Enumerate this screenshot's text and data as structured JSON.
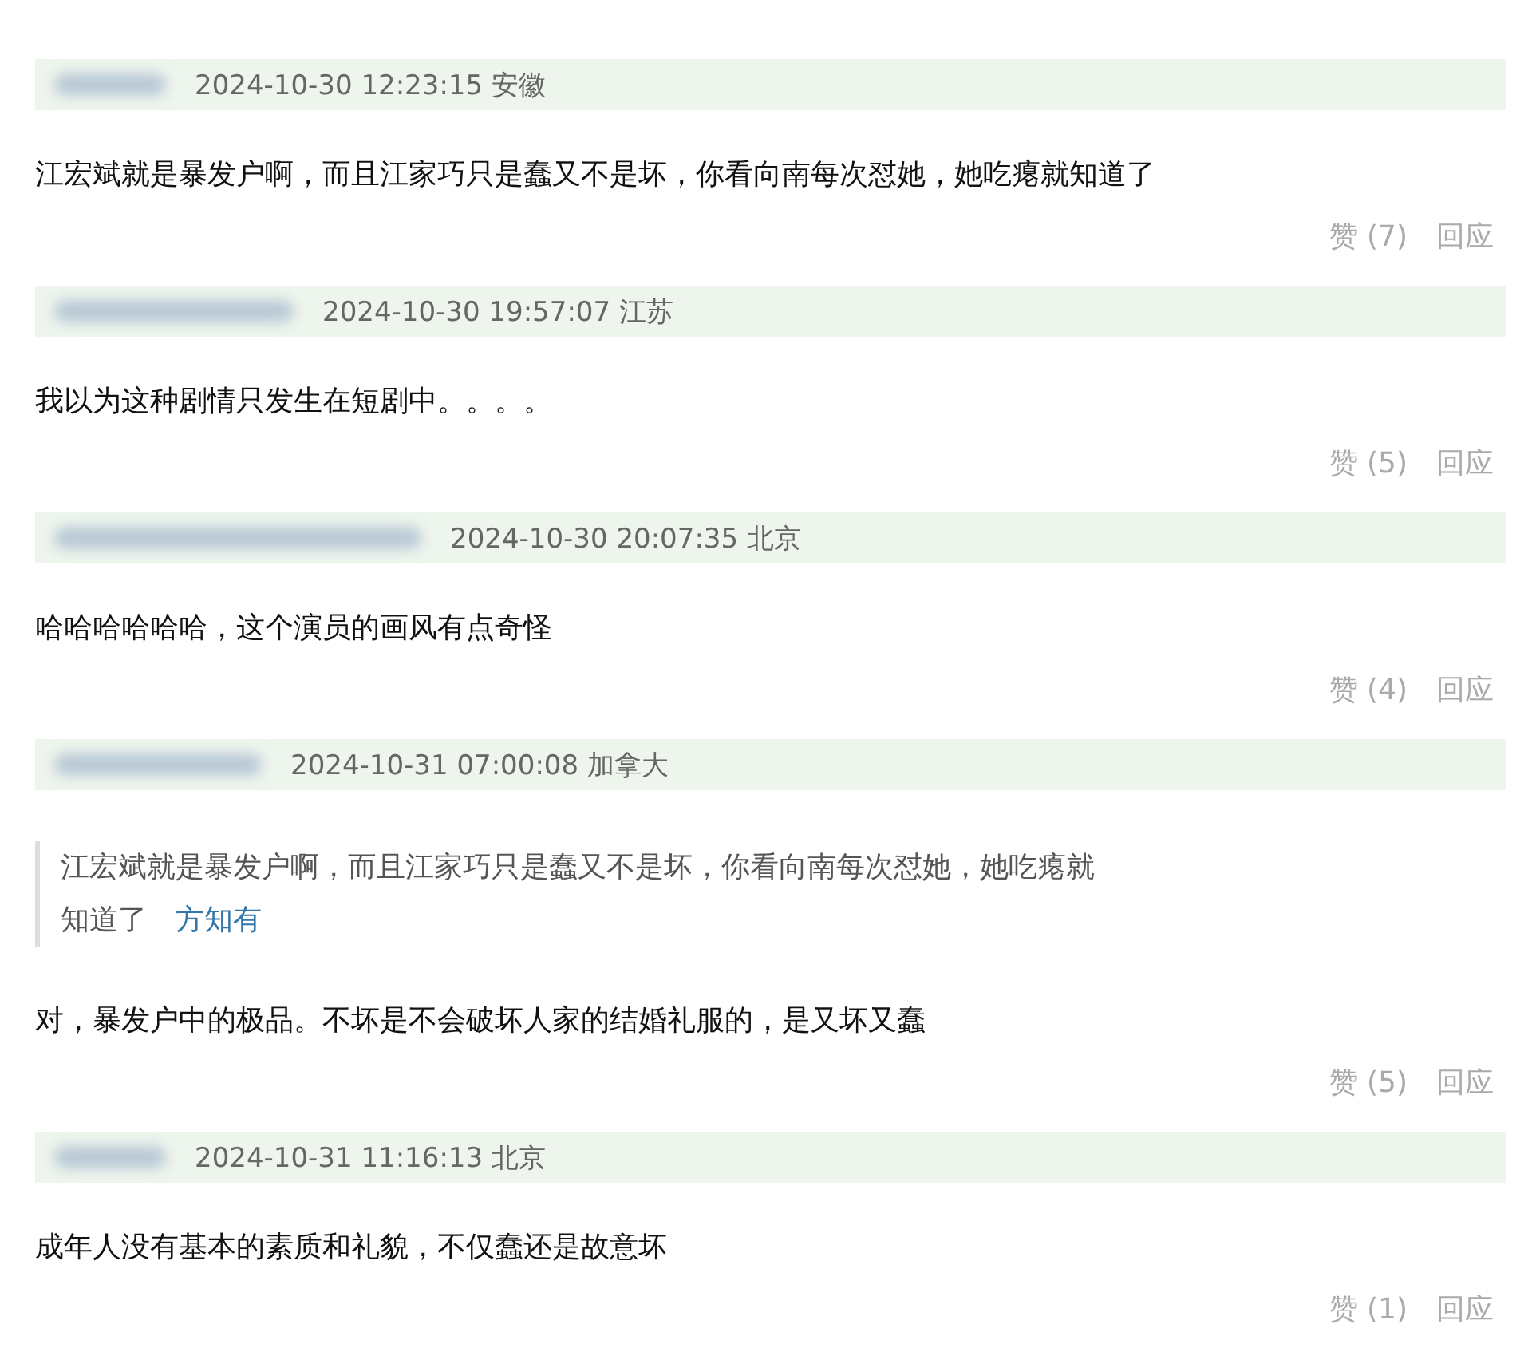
{
  "comments": [
    {
      "meta": "2024-10-30 12:23:15 安徽",
      "text": "江宏斌就是暴发户啊，而且江家巧只是蠢又不是坏，你看向南每次怼她，她吃瘪就知道了",
      "like": "赞 (7)",
      "reply": "回应"
    },
    {
      "meta": "2024-10-30 19:57:07 江苏",
      "text": "我以为这种剧情只发生在短剧中。。。。",
      "like": "赞 (5)",
      "reply": "回应"
    },
    {
      "meta": "2024-10-30 20:07:35 北京",
      "text": "哈哈哈哈哈哈，这个演员的画风有点奇怪",
      "like": "赞 (4)",
      "reply": "回应"
    },
    {
      "meta": "2024-10-31 07:00:08 加拿大",
      "quote": {
        "text": "江宏斌就是暴发户啊，而且江家巧只是蠢又不是坏，你看向南每次怼她，她吃瘪就知道了",
        "author": "方知有"
      },
      "text": "对，暴发户中的极品。不坏是不会破坏人家的结婚礼服的，是又坏又蠢",
      "like": "赞 (5)",
      "reply": "回应"
    },
    {
      "meta": "2024-10-31 11:16:13 北京",
      "text": "成年人没有基本的素质和礼貌，不仅蠢还是故意坏",
      "like": "赞 (1)",
      "reply": "回应"
    }
  ]
}
